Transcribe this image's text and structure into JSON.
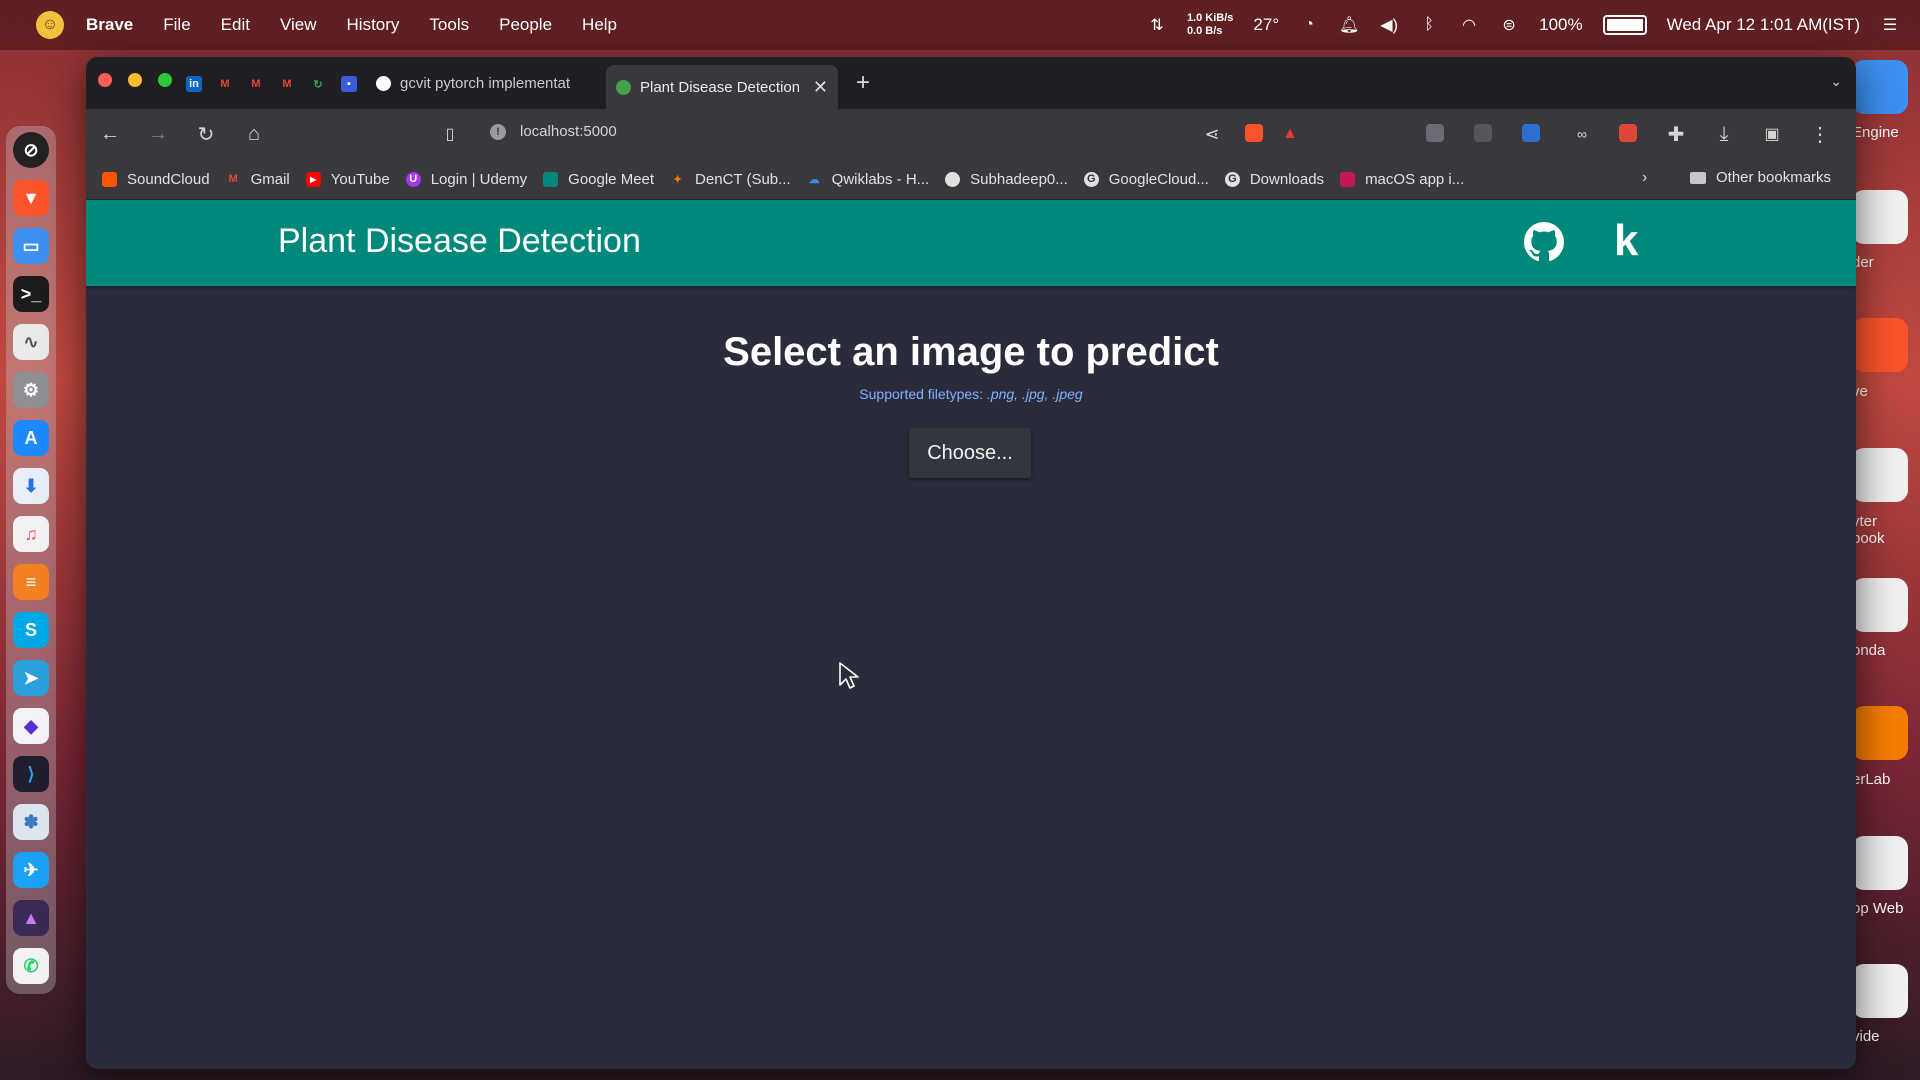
{
  "menubar": {
    "app": "Brave",
    "items": [
      "File",
      "Edit",
      "View",
      "History",
      "Tools",
      "People",
      "Help"
    ],
    "net_down": "1.0 KiB/s",
    "net_up": "0.0 B/s",
    "temperature": "27°",
    "battery": "100%",
    "datetime": "Wed Apr 12  1:01 AM(IST)"
  },
  "browser": {
    "tabs": [
      {
        "title": "gcvit pytorch implementatio",
        "active": false
      },
      {
        "title": "Plant Disease Detection",
        "active": true
      }
    ],
    "url": "localhost:5000",
    "bookmarks": [
      {
        "label": "SoundCloud",
        "icon": "soundcloud-icon",
        "color": "#ff5500"
      },
      {
        "label": "Gmail",
        "icon": "gmail-icon",
        "color": "#ea4335"
      },
      {
        "label": "YouTube",
        "icon": "youtube-icon",
        "color": "#ff0000"
      },
      {
        "label": "Login | Udemy",
        "icon": "udemy-icon",
        "color": "#a435f0"
      },
      {
        "label": "Google Meet",
        "icon": "meet-icon",
        "color": "#00897b"
      },
      {
        "label": "DenCT (Sub...",
        "icon": "denct-icon",
        "color": "#f57c00"
      },
      {
        "label": "Qwiklabs - H...",
        "icon": "qwiklabs-icon",
        "color": "#4285f4"
      },
      {
        "label": "Subhadeep0...",
        "icon": "github-icon",
        "color": "#e0e0e0"
      },
      {
        "label": "GoogleCloud...",
        "icon": "google-icon",
        "color": "#e0e0e0"
      },
      {
        "label": "Downloads",
        "icon": "google-icon",
        "color": "#e0e0e0"
      },
      {
        "label": "macOS app i...",
        "icon": "macos-app-icon",
        "color": "#c2185b"
      }
    ],
    "other_bookmarks": "Other bookmarks"
  },
  "page": {
    "brand": "Plant Disease Detection",
    "kaggle_letter": "k",
    "heading": "Select an image to predict",
    "supported_prefix": "Supported filetypes: ",
    "supported_types": ".png, .jpg, .jpeg",
    "choose_label": "Choose...",
    "accent": "#00897b",
    "background": "#2a2c3b"
  },
  "desktop": {
    "labels": [
      "Engine",
      "der",
      "ve",
      "yter\nbook",
      "onda",
      "erLab",
      "op Web",
      "vide"
    ]
  }
}
